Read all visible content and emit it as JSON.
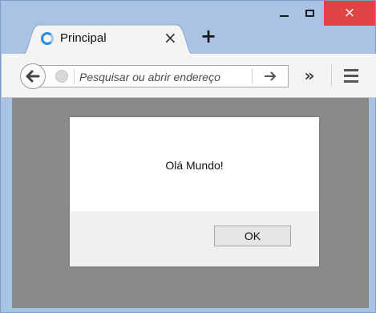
{
  "window": {
    "controls": {
      "minimize": "",
      "maximize": "",
      "close": "×"
    }
  },
  "tab": {
    "title": "Principal",
    "close_glyph": "×",
    "favicon": "loading-spinner-icon"
  },
  "new_tab": {
    "glyph": "+"
  },
  "toolbar": {
    "back_icon": "back-arrow-icon",
    "url_placeholder": "Pesquisar ou abrir endereço",
    "url_value": "",
    "go_icon": "forward-arrow-icon",
    "overflow_glyph": "»",
    "menu_icon": "hamburger-menu-icon"
  },
  "dialog": {
    "message": "Olá Mundo!",
    "ok_label": "OK"
  },
  "colors": {
    "close_button": "#e04343",
    "frame": "#a9c3e4",
    "page_overlay": "#8a8a8a"
  }
}
